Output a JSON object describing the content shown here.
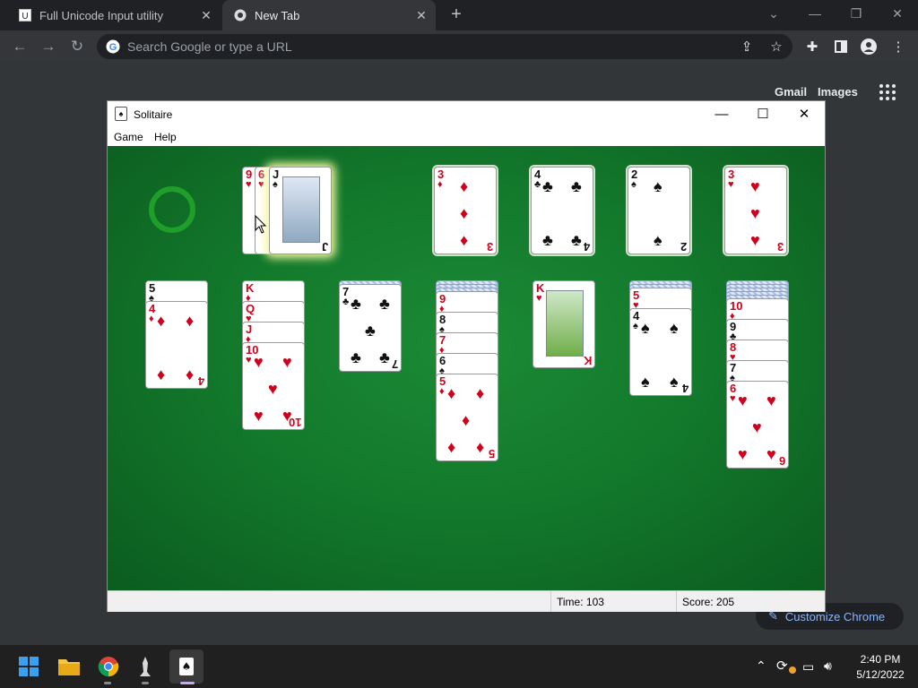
{
  "browser": {
    "tabs": [
      {
        "title": "Full Unicode Input utility",
        "active": false
      },
      {
        "title": "New Tab",
        "active": true
      }
    ],
    "omnibox_placeholder": "Search Google or type a URL",
    "new_tab_icon": "plus-icon"
  },
  "ntp": {
    "gmail": "Gmail",
    "images": "Images",
    "customize": "Customize Chrome"
  },
  "solitaire": {
    "title": "Solitaire",
    "menu": [
      "Game",
      "Help"
    ],
    "status": {
      "time_label": "Time:",
      "time": "103",
      "score_label": "Score:",
      "score": "205"
    },
    "waste": [
      {
        "rank": "9",
        "suit": "♥"
      },
      {
        "rank": "6",
        "suit": "♥"
      },
      {
        "rank": "J",
        "suit": "♠"
      }
    ],
    "foundations": [
      {
        "rank": "3",
        "suit": "♦"
      },
      {
        "rank": "4",
        "suit": "♣"
      },
      {
        "rank": "2",
        "suit": "♠"
      },
      {
        "rank": "3",
        "suit": "♥"
      }
    ],
    "tableau": [
      {
        "hidden": 0,
        "cards": [
          {
            "rank": "5",
            "suit": "♠"
          },
          {
            "rank": "4",
            "suit": "♦"
          }
        ]
      },
      {
        "hidden": 0,
        "cards": [
          {
            "rank": "K",
            "suit": "♦"
          },
          {
            "rank": "Q",
            "suit": "♥"
          },
          {
            "rank": "J",
            "suit": "♦"
          },
          {
            "rank": "10",
            "suit": "♥"
          }
        ]
      },
      {
        "hidden": 1,
        "cards": [
          {
            "rank": "7",
            "suit": "♣"
          }
        ]
      },
      {
        "hidden": 3,
        "cards": [
          {
            "rank": "9",
            "suit": "♦"
          },
          {
            "rank": "8",
            "suit": "♠"
          },
          {
            "rank": "7",
            "suit": "♦"
          },
          {
            "rank": "6",
            "suit": "♠"
          },
          {
            "rank": "5",
            "suit": "♦"
          }
        ]
      },
      {
        "hidden": 0,
        "cards": [
          {
            "rank": "K",
            "suit": "♥"
          }
        ]
      },
      {
        "hidden": 2,
        "cards": [
          {
            "rank": "5",
            "suit": "♥"
          },
          {
            "rank": "4",
            "suit": "♠"
          }
        ]
      },
      {
        "hidden": 5,
        "cards": [
          {
            "rank": "10",
            "suit": "♦"
          },
          {
            "rank": "9",
            "suit": "♣"
          },
          {
            "rank": "8",
            "suit": "♥"
          },
          {
            "rank": "7",
            "suit": "♠"
          },
          {
            "rank": "6",
            "suit": "♥"
          }
        ]
      }
    ]
  },
  "taskbar": {
    "time": "2:40 PM",
    "date": "5/12/2022"
  },
  "colors": {
    "felt": "#137a2c",
    "card_red": "#d0021b",
    "chrome_dark": "#202124",
    "accent_blue": "#8ab4f8"
  }
}
